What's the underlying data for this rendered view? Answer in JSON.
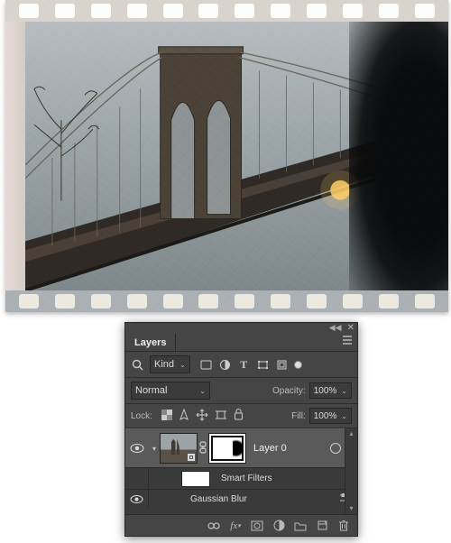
{
  "panel": {
    "title": "Layers",
    "filter": {
      "kind_label": "Kind",
      "search_icon": "search-icon"
    },
    "blend": {
      "mode": "Normal",
      "opacity_label": "Opacity:",
      "opacity_value": "100%"
    },
    "lock": {
      "label": "Lock:",
      "fill_label": "Fill:",
      "fill_value": "100%"
    },
    "layers": [
      {
        "name": "Layer 0",
        "visible": true,
        "expanded": true,
        "has_smart_filters": true,
        "smart_filters_label": "Smart Filters",
        "filters": [
          {
            "name": "Gaussian Blur",
            "visible": true
          }
        ]
      }
    ]
  }
}
